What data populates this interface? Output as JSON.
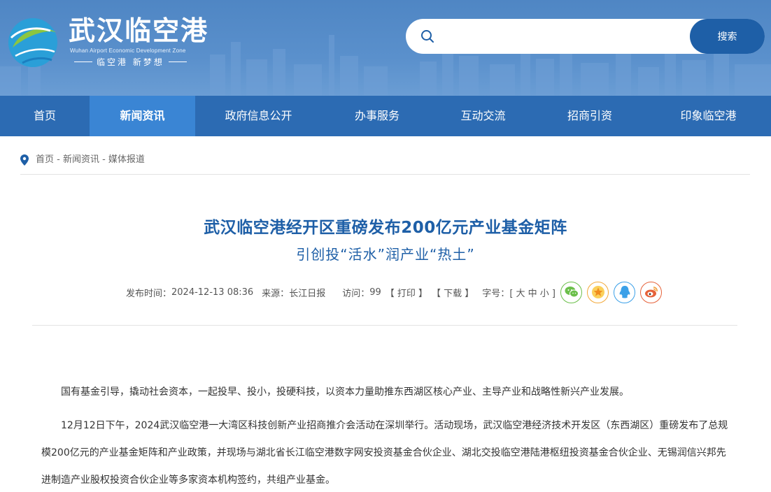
{
  "header": {
    "brand_cn": "武汉临空港",
    "brand_en": "Wuhan Airport Economic Development Zone",
    "slogan": "临空港 新梦想",
    "search_placeholder": "",
    "search_button": "搜索"
  },
  "nav": {
    "items": [
      {
        "label": "首页"
      },
      {
        "label": "新闻资讯",
        "active": true
      },
      {
        "label": "政府信息公开"
      },
      {
        "label": "办事服务"
      },
      {
        "label": "互动交流"
      },
      {
        "label": "招商引资"
      },
      {
        "label": "印象临空港"
      }
    ]
  },
  "breadcrumb": {
    "text": "首页 - 新闻资讯 - 媒体报道"
  },
  "article": {
    "title": "武汉临空港经开区重磅发布200亿元产业基金矩阵",
    "subtitle": "引创投“活水”润产业“热土”",
    "meta": {
      "publish_label": "发布时间：",
      "publish_time": "2024-12-13 08:36",
      "source_label": "来源：",
      "source": "长江日报",
      "visits_label": "访问：",
      "visits": "99",
      "print": "【 打印 】",
      "download": "【 下载 】",
      "font_label": "字号：",
      "font_sizes": "[ 大 中 小 ]"
    },
    "share_icons": [
      "wechat-icon",
      "star-icon",
      "qq-icon",
      "weibo-icon"
    ],
    "paragraphs": [
      "国有基金引导，撬动社会资本，一起投早、投小，投硬科技，以资本力量助推东西湖区核心产业、主导产业和战略性新兴产业发展。",
      "12月12日下午，2024武汉临空港一大湾区科技创新产业招商推介会活动在深圳举行。活动现场，武汉临空港经济技术开发区（东西湖区）重磅发布了总规模200亿元的产业基金矩阵和产业政策，并现场与湖北省长江临空港数字网安投资基金合伙企业、湖北交投临空港陆港枢纽投资基金合伙企业、无锡润信兴邦先进制造产业股权投资合伙企业等多家资本机构签约，共组产业基金。"
    ]
  },
  "colors": {
    "header_bg": "#4f86c4",
    "nav_bg": "#2c6bb3",
    "nav_active": "#3a85d4",
    "title": "#1e5fa7"
  }
}
